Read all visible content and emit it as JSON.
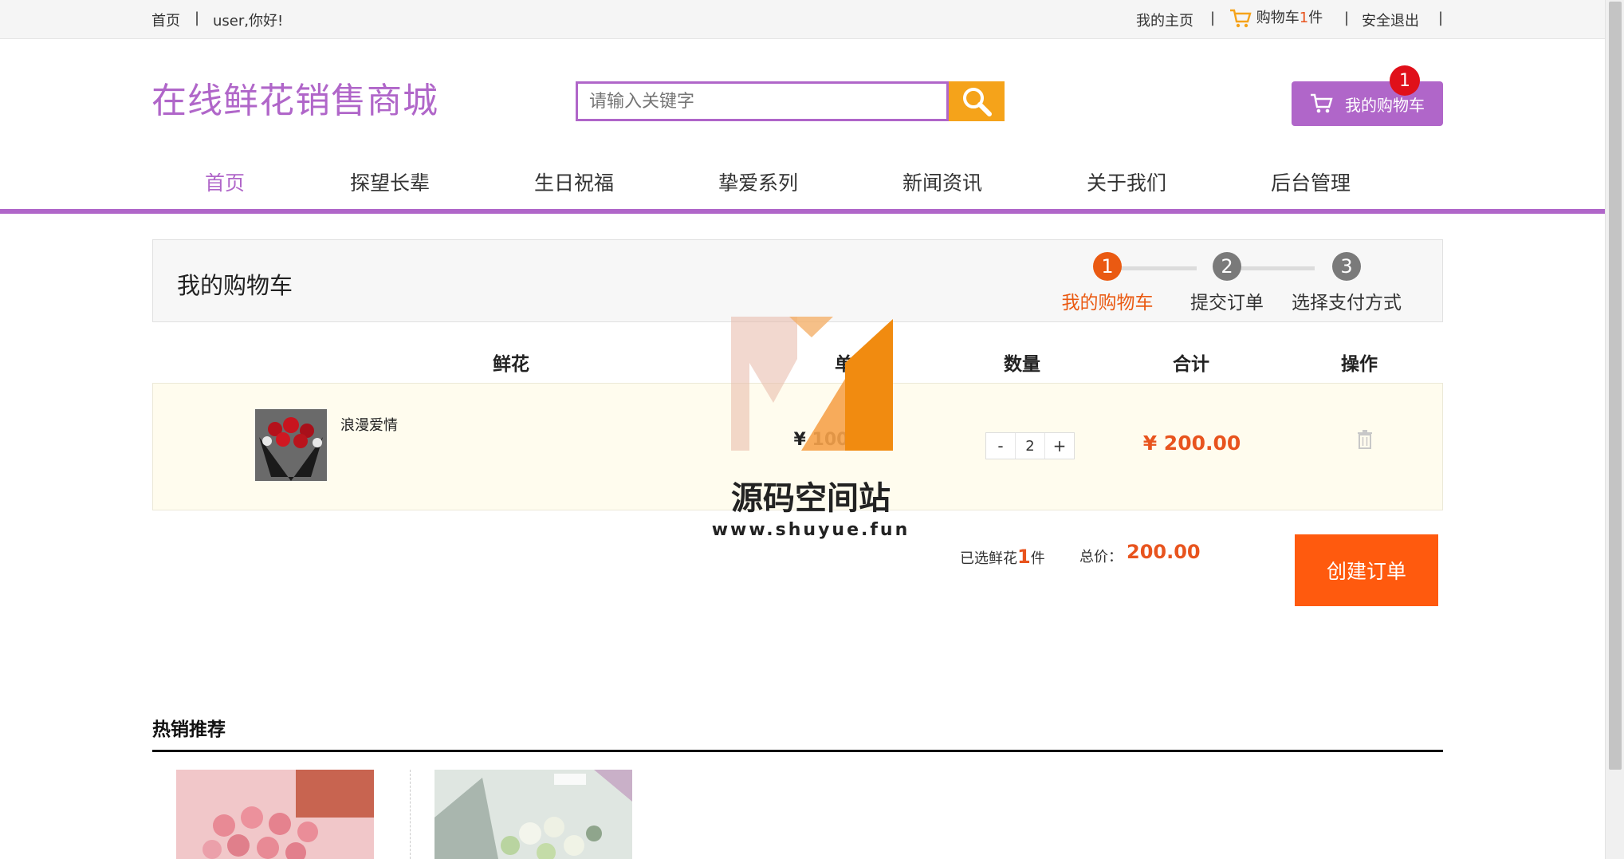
{
  "topbar": {
    "home": "首页",
    "sep": "|",
    "greeting": "user,你好!",
    "my_home": "我的主页",
    "cart_prefix": "购物车",
    "cart_count": "1",
    "cart_suffix": "件",
    "logout": "安全退出"
  },
  "header": {
    "logo": "在线鲜花销售商城",
    "search_placeholder": "请输入关键字",
    "cart_button": "我的购物车",
    "cart_badge": "1"
  },
  "nav": [
    "首页",
    "探望长辈",
    "生日祝福",
    "挚爱系列",
    "新闻资讯",
    "关于我们",
    "后台管理"
  ],
  "cart": {
    "title": "我的购物车",
    "steps": [
      {
        "num": "1",
        "label": "我的购物车",
        "active": true
      },
      {
        "num": "2",
        "label": "提交订单",
        "active": false
      },
      {
        "num": "3",
        "label": "选择支付方式",
        "active": false
      }
    ],
    "columns": [
      "鲜花",
      "单价",
      "数量",
      "合计",
      "操作"
    ],
    "items": [
      {
        "name": "浪漫爱情",
        "unit_price": "¥ 100",
        "qty": "2",
        "qty_minus": "-",
        "qty_plus": "+",
        "subtotal": "¥ 200.00"
      }
    ],
    "summary": {
      "selected_prefix": "已选鲜花",
      "selected_count": "1",
      "selected_suffix": "件",
      "total_label": "总价：",
      "total_value": "200.00"
    },
    "create_order": "创建订单"
  },
  "hot": {
    "title": "热销推荐"
  },
  "watermark": {
    "title": "源码空间站",
    "url": "www.shuyue.fun"
  },
  "colors": {
    "brand": "#b066c9",
    "accent": "#e8541e",
    "search_btn": "#f5a31a",
    "row_bg": "#fffcee"
  }
}
